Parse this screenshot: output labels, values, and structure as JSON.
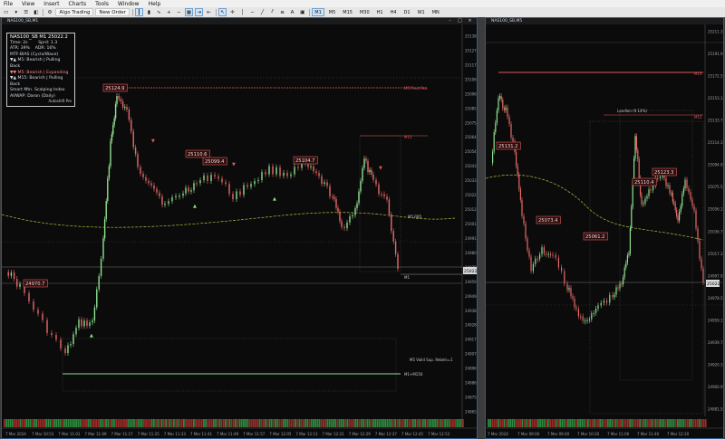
{
  "menu": [
    "File",
    "View",
    "Insert",
    "Charts",
    "Tools",
    "Window",
    "Help"
  ],
  "toolbar": {
    "algo_trading": "Algo Trading",
    "new_order": "New Order",
    "timeframes": [
      "M1",
      "M5",
      "M15",
      "M30",
      "H1",
      "H4",
      "D1",
      "W1",
      "MN"
    ]
  },
  "left_chart": {
    "window_title": "NAS100_SB,M1",
    "info": {
      "title": "NAS100_SB M1 25022.2",
      "time_label": "Time: 2s",
      "spread_label": "Sprd: 1.3",
      "atr_label": "ATR: 39%",
      "adr_label": "ADR: 16%",
      "mtf_header": "MTF-BIAS (Cycle/Wave)",
      "line1": "▼▲ M1: Bearish | Pulling Back",
      "line2": "▼▼ M5: Bearish | Expanding",
      "line3": "▼▲ M15: Bearish | Pulling Back",
      "line4": "Smart Mtn. Scalping Index",
      "line5": "AVWAP: Daron (Daily)",
      "footer": "Autoshift Pro"
    },
    "price_labels": [
      "25138.0",
      "25127.5",
      "25117.0",
      "25106.5",
      "25096.0",
      "25085.5",
      "25075.0",
      "25064.5",
      "25054.0",
      "25043.5",
      "25033.0",
      "25022.5",
      "25012.0",
      "25001.5",
      "24991.0",
      "24980.5",
      "24970.0",
      "24959.5",
      "24949.0",
      "24938.5",
      "24928.0",
      "24917.5",
      "24907.0",
      "24896.5",
      "24886.0",
      "24875.5",
      "24865.0"
    ],
    "current_price": "25022.2",
    "time_labels": [
      "7 Mar 2024",
      "7 Mar 10:53",
      "7 Mar 11:01",
      "7 Mar 11:09",
      "7 Mar 11:17",
      "7 Mar 11:25",
      "7 Mar 11:33",
      "7 Mar 11:41",
      "7 Mar 11:49",
      "7 Mar 11:57",
      "7 Mar 12:05",
      "7 Mar 12:13",
      "7 Mar 12:21",
      "7 Mar 12:29",
      "7 Mar 12:37",
      "7 Mar 12:45",
      "7 Mar 12:53"
    ],
    "annotations": {
      "peak": "25124.9",
      "mid1": "25110.6",
      "mid2": "25099.4",
      "mid3": "25104.7",
      "low": "24970.7",
      "r1": "M5 Pivot Res",
      "m15": "M15",
      "m5": "M5 RB5",
      "m1": "M1",
      "support": "M5 Valid Sup. Rebels=1",
      "m1_bottom": "M1+M150"
    }
  },
  "right_chart": {
    "window_title": "NAS100_SB,M5",
    "price_labels": [
      "25211.3",
      "25191.9",
      "25172.5",
      "25153.1",
      "25133.7",
      "25114.3",
      "25094.9",
      "25075.5",
      "25056.1",
      "25036.7",
      "25017.3",
      "24997.9",
      "24978.5",
      "24959.1",
      "24939.7",
      "24920.3",
      "24900.9",
      "24881.5"
    ],
    "current_price": "25022.2",
    "time_labels": [
      "7 Mar 2024",
      "7 Mar 09:00",
      "7 Mar 09:40",
      "7 Mar 10:20",
      "7 Mar 11:00",
      "7 Mar 11:40",
      "7 Mar 12:20"
    ],
    "annotations": {
      "a1": "25131.2",
      "a2": "25073.4",
      "a3": "25061.2",
      "a4": "25123.3",
      "a5": "25110.4",
      "top": "Landlon (9.14%)",
      "r1": "M15",
      "r2": "M15"
    }
  },
  "colors": {
    "bull": "#8fe28f",
    "bear": "#e86a6a",
    "vwap": "#b8b84a",
    "level": "#e05a5a",
    "support": "#8fe28f"
  }
}
